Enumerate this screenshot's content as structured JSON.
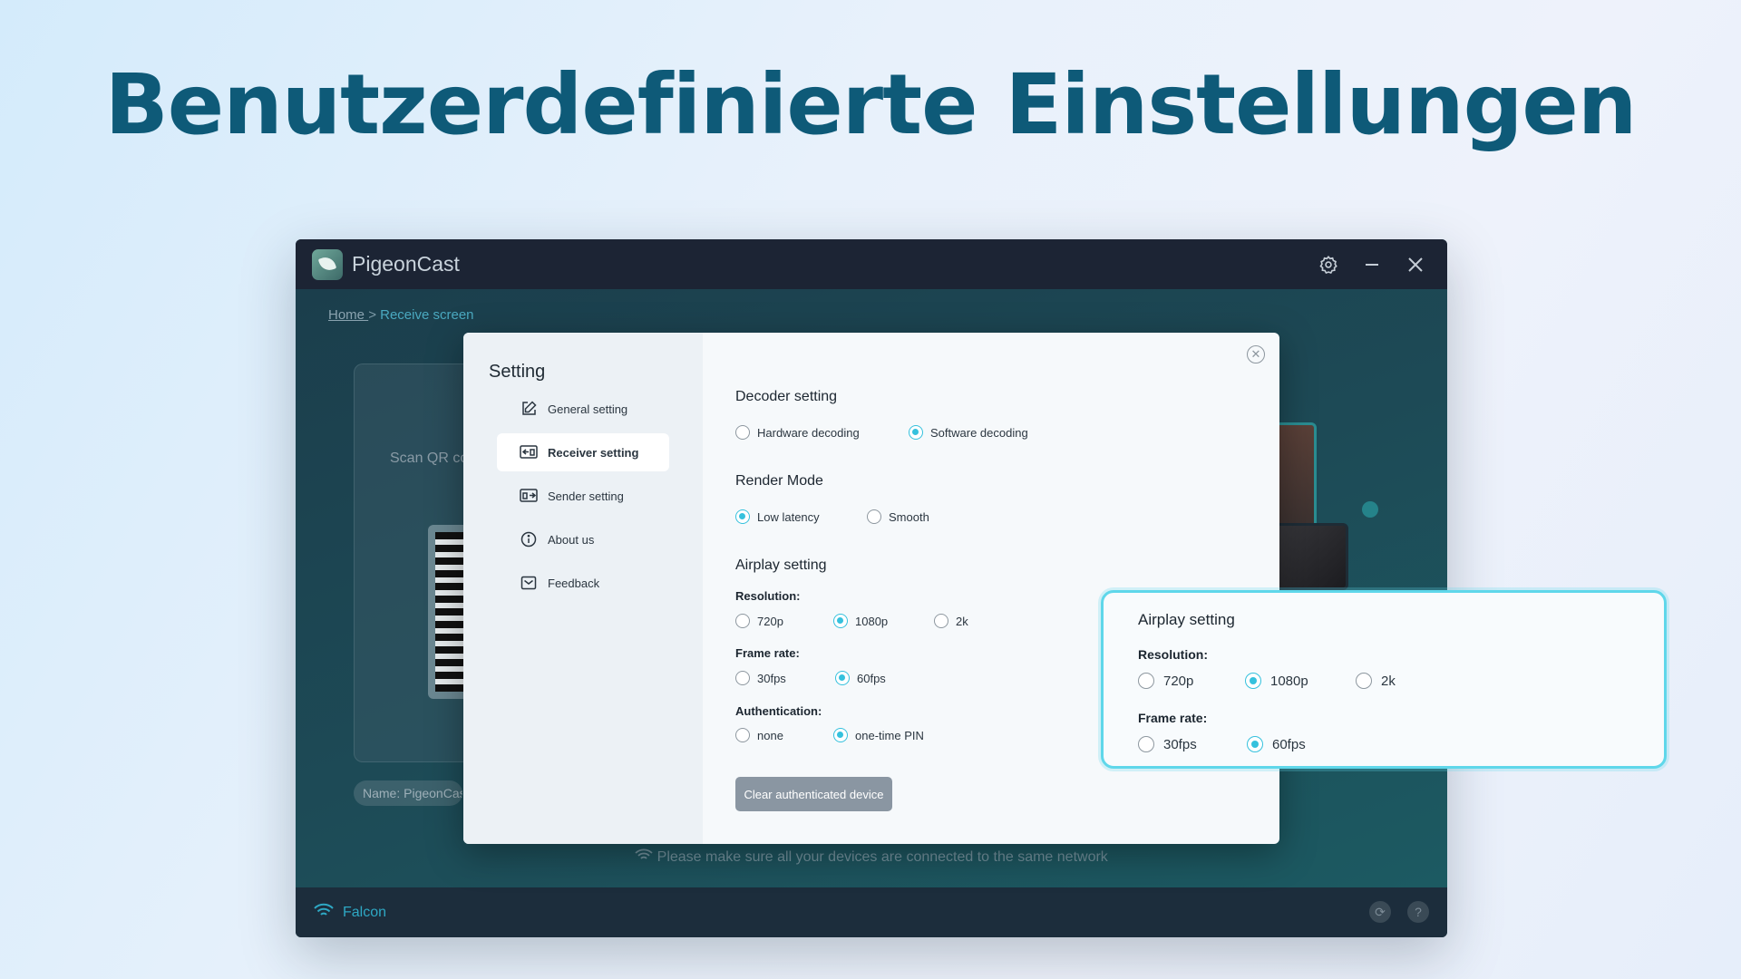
{
  "headline": "Benutzerdefinierte Einstellungen",
  "app": {
    "name": "PigeonCast",
    "breadcrumb": {
      "home": "Home ",
      "separator": ">",
      "current": "Receive screen"
    },
    "bg_scan_text": "Scan QR co",
    "bg_name": "Name: PigeonCas",
    "network_hint": "Please make sure all your devices are connected to the same network",
    "network_name": "Falcon",
    "icons": {
      "settings": "gear-icon",
      "minimize": "minimize-icon",
      "close": "close-icon",
      "refresh": "refresh-icon",
      "help": "help-icon",
      "wifi": "wifi-icon"
    }
  },
  "dialog": {
    "title": "Setting",
    "nav": [
      {
        "label": "General setting",
        "icon": "edit-icon",
        "active": false
      },
      {
        "label": "Receiver setting",
        "icon": "receiver-icon",
        "active": true
      },
      {
        "label": "Sender setting",
        "icon": "sender-icon",
        "active": false
      },
      {
        "label": "About us",
        "icon": "info-icon",
        "active": false
      },
      {
        "label": "Feedback",
        "icon": "feedback-icon",
        "active": false
      }
    ],
    "decoder": {
      "title": "Decoder setting",
      "options": [
        {
          "label": "Hardware decoding",
          "selected": false
        },
        {
          "label": "Software decoding",
          "selected": true
        }
      ]
    },
    "render": {
      "title": "Render Mode",
      "options": [
        {
          "label": "Low latency",
          "selected": true
        },
        {
          "label": "Smooth",
          "selected": false
        }
      ]
    },
    "airplay": {
      "title": "Airplay setting",
      "resolution_label": "Resolution:",
      "resolution": [
        {
          "label": "720p",
          "selected": false
        },
        {
          "label": "1080p",
          "selected": true
        },
        {
          "label": "2k",
          "selected": false
        }
      ],
      "framerate_label": "Frame rate:",
      "framerate": [
        {
          "label": "30fps",
          "selected": false
        },
        {
          "label": "60fps",
          "selected": true
        }
      ],
      "auth_label": "Authentication:",
      "auth": [
        {
          "label": "none",
          "selected": false
        },
        {
          "label": "one-time PIN",
          "selected": true
        }
      ]
    },
    "clear_button": "Clear authenticated device"
  },
  "callout": {
    "title": "Airplay setting",
    "resolution_label": "Resolution:",
    "resolution": [
      {
        "label": "720p",
        "selected": false
      },
      {
        "label": "1080p",
        "selected": true
      },
      {
        "label": "2k",
        "selected": false
      }
    ],
    "framerate_label": "Frame rate:",
    "framerate": [
      {
        "label": "30fps",
        "selected": false
      },
      {
        "label": "60fps",
        "selected": true
      }
    ]
  },
  "colors": {
    "accent": "#35c1dd",
    "headline": "#0e5a78",
    "titlebar": "#1c2434",
    "callout_border": "#5fd7ea"
  }
}
